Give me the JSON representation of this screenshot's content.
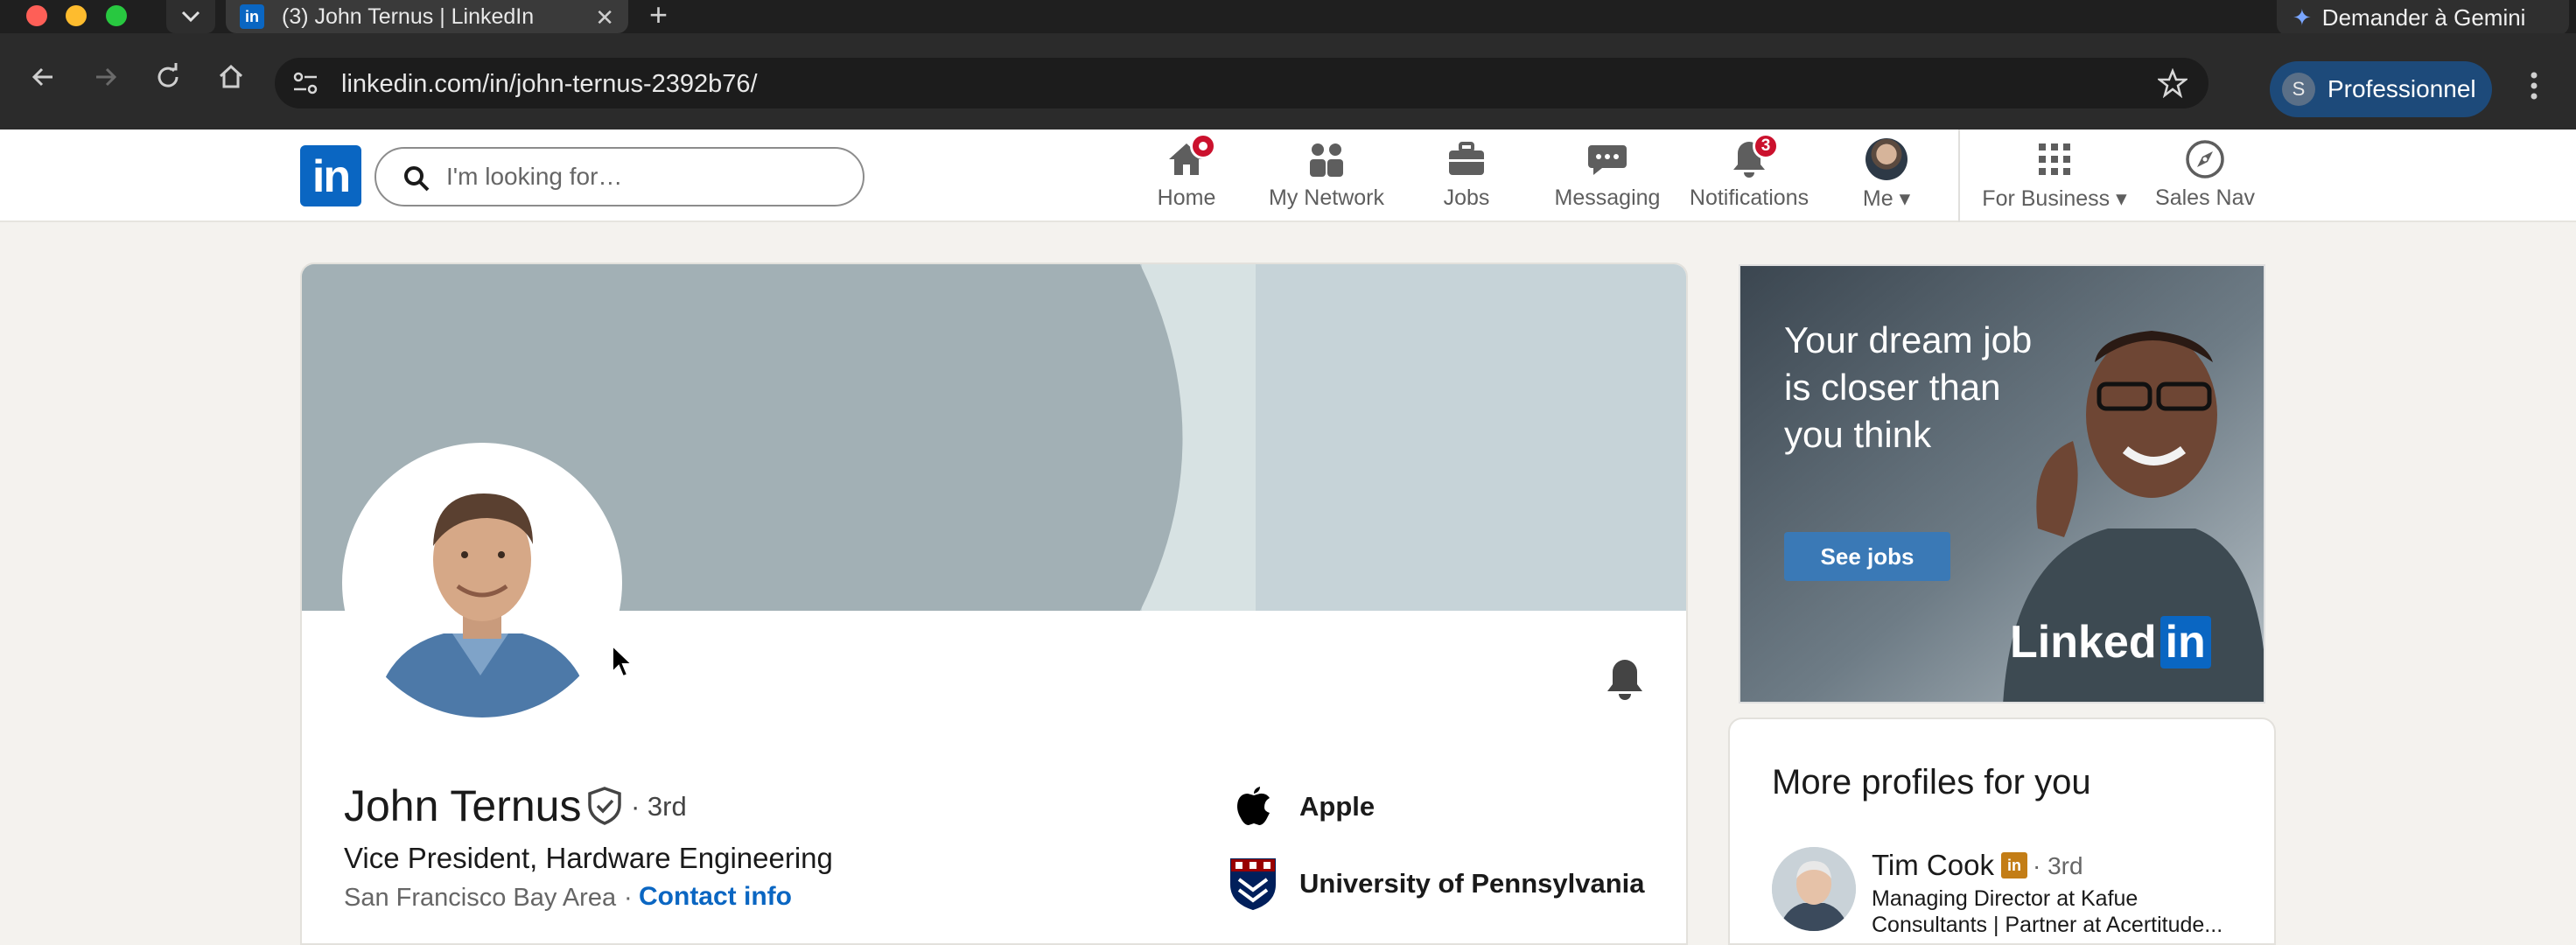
{
  "browser": {
    "tab_title": "(3) John Ternus | LinkedIn",
    "tab_favicon_text": "in",
    "new_tab_symbol": "+",
    "close_symbol": "✕",
    "gemini_label": "Demander à Gemini",
    "url": "linkedin.com/in/john-ternus-2392b76/",
    "profile_initial": "S",
    "profile_label": "Professionnel"
  },
  "linkedin": {
    "logo_text": "in",
    "search_placeholder": "I'm looking for…",
    "nav": {
      "home": "Home",
      "network": "My Network",
      "jobs": "Jobs",
      "messaging": "Messaging",
      "notifications": "Notifications",
      "notifications_count": "3",
      "me": "Me",
      "for_business": "For Business",
      "sales_nav": "Sales Nav"
    },
    "colors": {
      "brand": "#0a66c2",
      "badge": "#cb112d"
    }
  },
  "profile": {
    "name": "John Ternus",
    "degree": "· 3rd",
    "headline": "Vice President, Hardware Engineering",
    "location": "San Francisco Bay Area",
    "separator": "·",
    "contact_link": "Contact info",
    "companies": [
      {
        "name": "Apple",
        "logo": "apple-logo"
      },
      {
        "name": "University of Pennsylvania",
        "logo": "upenn-shield"
      }
    ]
  },
  "ad": {
    "copy": "Your dream job is closer than you think",
    "button": "See jobs",
    "brand_word": "Linked",
    "brand_in": "in"
  },
  "more_profiles": {
    "title": "More profiles for you",
    "items": [
      {
        "name": "Tim Cook",
        "badge": "in",
        "degree": "· 3rd",
        "headline": "Managing Director at Kafue Consultants | Partner at Acertitude..."
      }
    ]
  }
}
